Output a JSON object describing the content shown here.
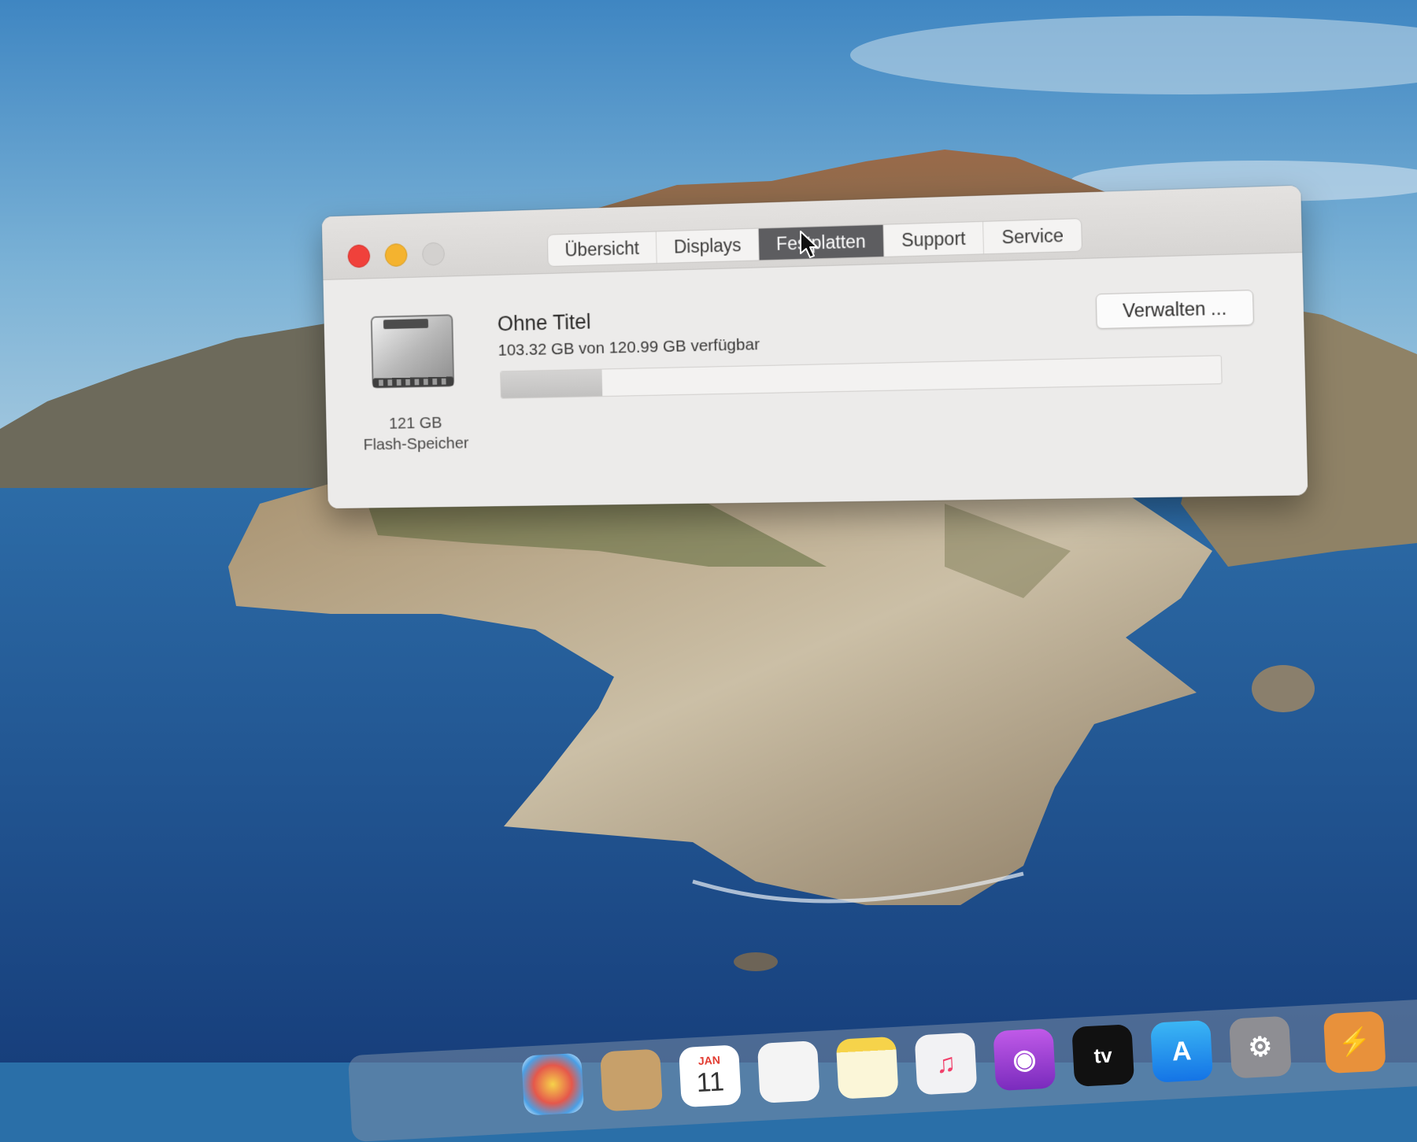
{
  "window": {
    "tabs": [
      {
        "label": "Übersicht",
        "active": false
      },
      {
        "label": "Displays",
        "active": false
      },
      {
        "label": "Festplatten",
        "active": true
      },
      {
        "label": "Support",
        "active": false
      },
      {
        "label": "Service",
        "active": false
      }
    ],
    "disk": {
      "size_line": "121 GB",
      "type_line": "Flash-Speicher",
      "icon": "internal-drive-icon"
    },
    "volume": {
      "name": "Ohne Titel",
      "availability": "103.32 GB von 120.99 GB verfügbar",
      "used_fraction": 0.146
    },
    "manage_button": "Verwalten ..."
  },
  "dock": {
    "items": [
      {
        "icon": "photos-icon"
      },
      {
        "icon": "contacts-icon"
      },
      {
        "icon": "calendar-icon",
        "month": "JAN",
        "day": "11"
      },
      {
        "icon": "reminders-icon"
      },
      {
        "icon": "notes-icon"
      },
      {
        "icon": "music-icon"
      },
      {
        "icon": "podcasts-icon"
      },
      {
        "icon": "apple-tv-icon",
        "label": "tv"
      },
      {
        "icon": "app-store-icon"
      },
      {
        "icon": "system-preferences-icon"
      },
      {
        "icon": "reeder-icon"
      }
    ]
  }
}
